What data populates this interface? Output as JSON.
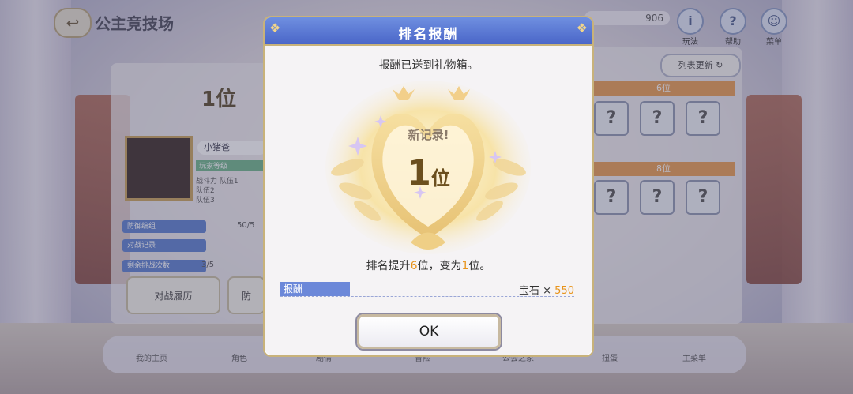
{
  "header": {
    "back_icon": "back-arrow-icon",
    "title": "公主竞技场",
    "counter": "906",
    "icons": [
      {
        "name": "info-icon",
        "glyph": "i",
        "label": "玩法"
      },
      {
        "name": "help-icon",
        "glyph": "?",
        "label": "帮助"
      },
      {
        "name": "menu-icon",
        "glyph": "☺",
        "label": "菜单"
      }
    ]
  },
  "left_panel": {
    "rank": "1位",
    "player_name": "小猪爸",
    "green_tag": "玩家等级",
    "info_lines": [
      "战斗力  队伍1",
      "队伍2",
      "队伍3"
    ],
    "blue_bar_1": "防御编组",
    "blue_bar_1_value": "50/5",
    "blue_bar_2": "对战记录",
    "blue_bar_3": "剩余挑战次数",
    "blue_bar_3_value": "3/5",
    "btn_battle_log": "对战履历",
    "btn_other": "防"
  },
  "right_panel": {
    "refresh_label": "列表更新",
    "band_1": "6位",
    "band_2": "8位",
    "card_glyph": "?"
  },
  "bottom_nav": [
    "我的主页",
    "角色",
    "剧情",
    "冒险",
    "公会之家",
    "扭蛋",
    "主菜单"
  ],
  "modal": {
    "title": "排名报酬",
    "sent_message": "报酬已送到礼物箱。",
    "new_record": "新记录!",
    "rank_number": "1",
    "rank_unit": "位",
    "promo_prefix": "排名提升",
    "promo_rise": "6",
    "promo_mid": "位，变为",
    "promo_new_rank": "1",
    "promo_suffix": "位。",
    "reward_label": "报酬",
    "reward_item": "宝石 × ",
    "reward_qty": "550",
    "ok_label": "OK"
  },
  "colors": {
    "modal_header": "#4a66c8",
    "highlight": "#e8931a",
    "gold_border": "#c8b27a"
  }
}
